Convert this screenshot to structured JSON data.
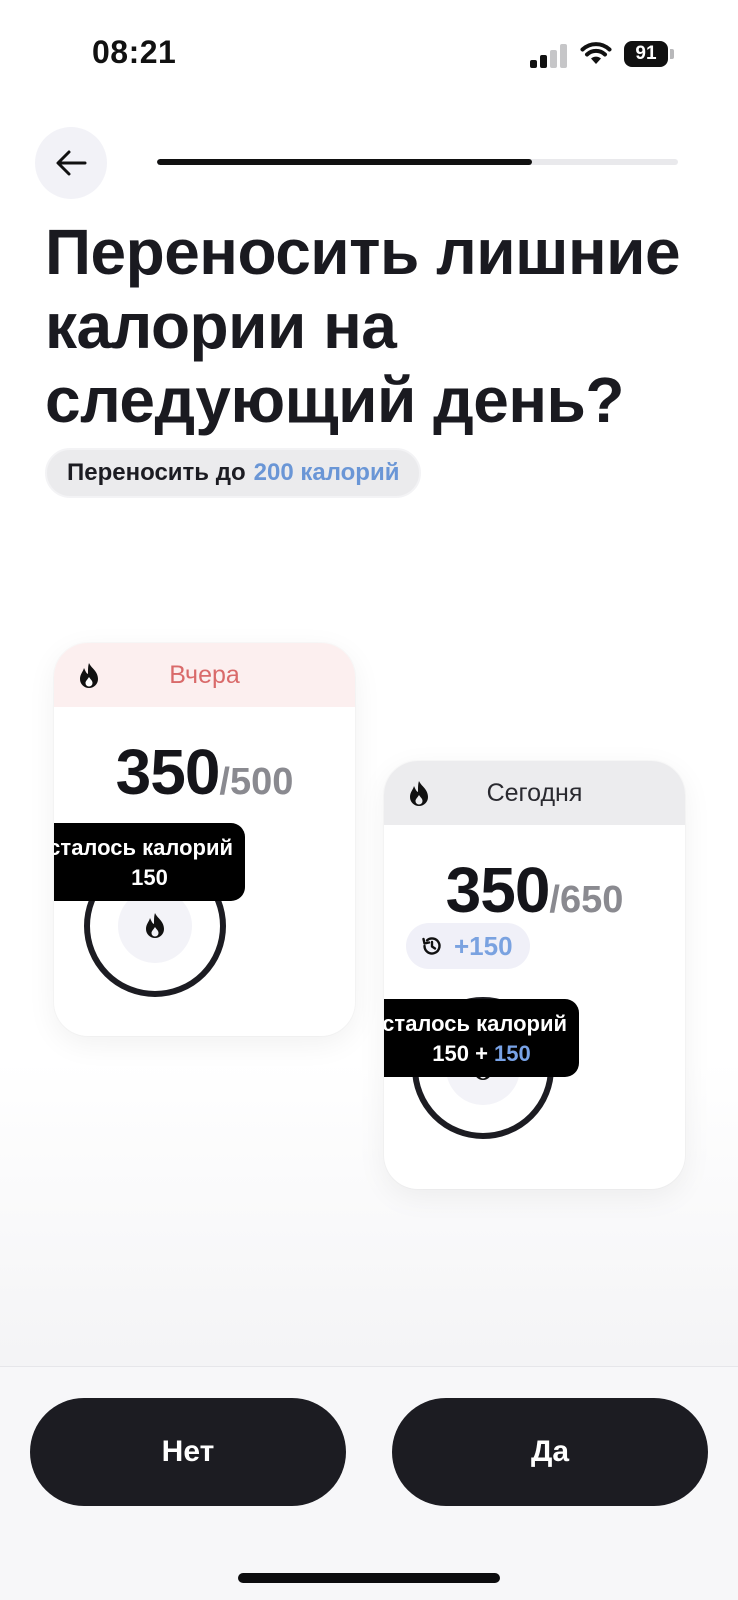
{
  "status_bar": {
    "time": "08:21",
    "battery_level": "91",
    "signal_bars_filled": 2,
    "signal_bars_total": 4
  },
  "header": {
    "back_icon": "arrow-left-icon",
    "onboarding_progress": 0.72
  },
  "title": "Переносить лишние калории на следующий день?",
  "carry_limit": {
    "prefix": "Переносить до",
    "amount": "200 калорий"
  },
  "yesterday_card": {
    "icon": "flame-icon",
    "label": "Вчера",
    "consumed": "350",
    "goal": "/500",
    "tooltip_title": "осталось калорий",
    "tooltip_value": "150"
  },
  "today_card": {
    "icon": "flame-icon",
    "label": "Сегодня",
    "consumed": "350",
    "goal": "/650",
    "carryover_icon": "history-icon",
    "carryover": "+150",
    "tooltip_title": "осталось калорий",
    "tooltip_base": "150",
    "tooltip_plus": "+",
    "tooltip_extra": "150"
  },
  "actions": {
    "no_label": "Нет",
    "yes_label": "Да"
  },
  "colors": {
    "accent_blue": "#6a96d6",
    "yesterday_red": "#d96a6a",
    "dark": "#1c1c22"
  }
}
